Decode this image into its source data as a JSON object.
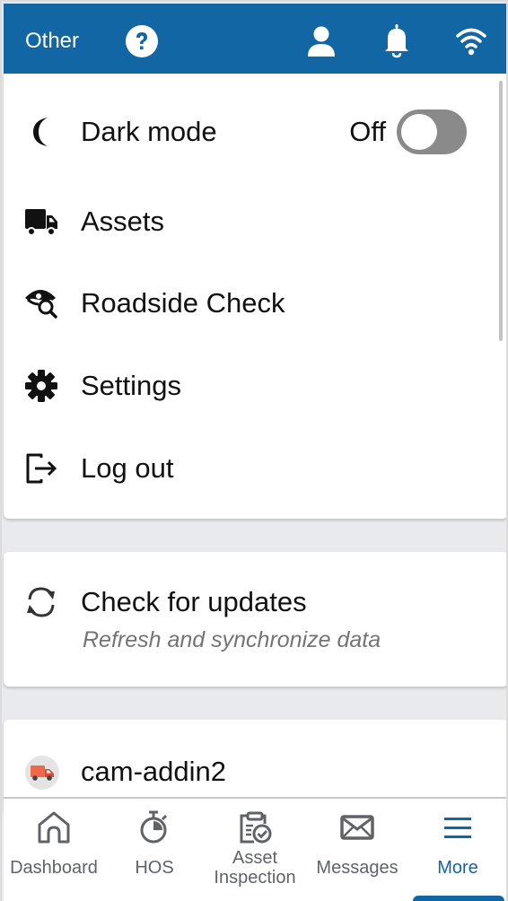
{
  "header": {
    "title": "Other",
    "icons": [
      "help-icon",
      "user-icon",
      "bell-icon",
      "wifi-icon"
    ]
  },
  "menu": {
    "items": [
      {
        "label": "Dark mode",
        "icon": "moon-icon",
        "toggle": {
          "state_label": "Off",
          "on": false
        }
      },
      {
        "label": "Assets",
        "icon": "truck-icon"
      },
      {
        "label": "Roadside Check",
        "icon": "eye-search-icon"
      },
      {
        "label": "Settings",
        "icon": "gear-icon"
      },
      {
        "label": "Log out",
        "icon": "logout-icon"
      }
    ]
  },
  "updates": {
    "label": "Check for updates",
    "sublabel": "Refresh and synchronize data",
    "icon": "sync-icon"
  },
  "vehicle": {
    "label": "cam-addin2",
    "icon": "vehicle-truck-icon",
    "icon_color": "#e8553a"
  },
  "bottom_nav": {
    "items": [
      {
        "label": "Dashboard",
        "icon": "home-icon"
      },
      {
        "label": "HOS",
        "icon": "stopwatch-icon"
      },
      {
        "label": "Asset Inspection",
        "label_line1": "Asset",
        "label_line2": "Inspection",
        "icon": "clipboard-check-icon"
      },
      {
        "label": "Messages",
        "icon": "envelope-icon"
      },
      {
        "label": "More",
        "icon": "hamburger-icon",
        "active": true
      }
    ]
  },
  "colors": {
    "brand": "#1166a3",
    "background": "#e8eaed",
    "toggle_off": "#8a8a8a",
    "nav_inactive": "#5f6368"
  }
}
